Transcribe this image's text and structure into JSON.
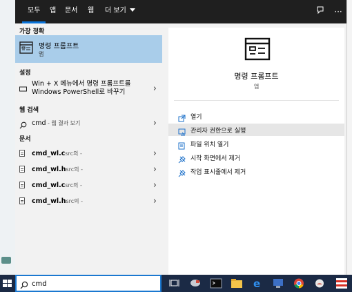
{
  "tabs": [
    {
      "label": "모두",
      "active": true
    },
    {
      "label": "앱"
    },
    {
      "label": "문서"
    },
    {
      "label": "웹"
    },
    {
      "label": "더 보기"
    }
  ],
  "top_icons": {
    "feedback": "feedback-icon",
    "more": "···"
  },
  "sections": {
    "best_match": "가장 정확",
    "settings": "설정",
    "web": "웹 검색",
    "documents": "문서"
  },
  "best_match": {
    "name": "명령 프롬프트",
    "type": "앱"
  },
  "settings_item": {
    "line1": "Win + X 메뉴에서 명령 프롬프트를",
    "line2": "Windows PowerShell로 바꾸기"
  },
  "web_item": {
    "query": "cmd",
    "suffix": " - 웹 결과 보기"
  },
  "documents": [
    {
      "name": "cmd_wl.c",
      "path": "src의 -"
    },
    {
      "name": "cmd_wl.h",
      "path": "src의 -"
    },
    {
      "name": "cmd_wl.c",
      "path": "src의 -"
    },
    {
      "name": "cmd_wl.h",
      "path": "src의 -"
    }
  ],
  "detail": {
    "title": "명령 프롬프트",
    "subtitle": "앱",
    "actions": [
      {
        "label": "열기",
        "icon": "open-icon"
      },
      {
        "label": "관리자 권한으로 실행",
        "icon": "admin-icon",
        "highlighted": true
      },
      {
        "label": "파일 위치 열기",
        "icon": "folder-icon"
      },
      {
        "label": "시작 화면에서 제거",
        "icon": "unpin-icon"
      },
      {
        "label": "작업 표시줄에서 제거",
        "icon": "unpin-icon"
      }
    ]
  },
  "search": {
    "value": "cmd"
  },
  "colors": {
    "accent": "#0a74da",
    "selected": "#a9cdea",
    "taskbar": "#1b2a45"
  }
}
